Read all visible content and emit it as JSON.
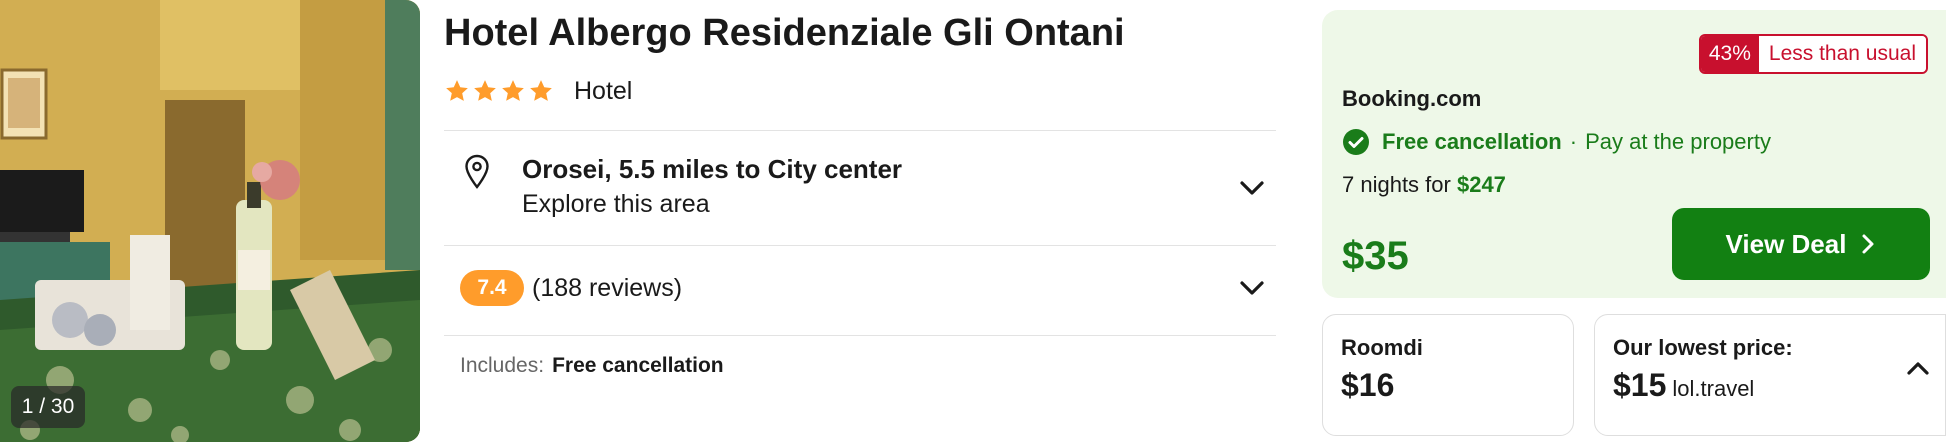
{
  "photo": {
    "counter": "1 / 30"
  },
  "hotel": {
    "name": "Hotel Albergo Residenziale Gli Ontani",
    "stars": 4,
    "type": "Hotel"
  },
  "location": {
    "title": "Orosei, 5.5 miles to City center",
    "subtitle": "Explore this area"
  },
  "reviews": {
    "score": "7.4",
    "count": "(188 reviews)"
  },
  "includes": {
    "label": "Includes:",
    "value": "Free cancellation"
  },
  "deal": {
    "badge_pct": "43%",
    "badge_text": "Less than usual",
    "provider": "Booking.com",
    "free_cancel": "Free cancellation",
    "separator": "·",
    "pay": "Pay at the property",
    "nights_text": "7 nights for",
    "nights_total": "$247",
    "price": "$35",
    "button": "View Deal"
  },
  "alt_price": {
    "provider": "Roomdi",
    "price": "$16"
  },
  "lowest_price": {
    "label": "Our lowest price:",
    "price": "$15",
    "provider": "lol.travel"
  },
  "colors": {
    "brand_green": "#128012",
    "price_green": "#1a7c1a",
    "deal_bg": "#eef8e8",
    "badge_red": "#c8102e",
    "score_orange": "#ff9c2b",
    "star_orange": "#ff9c2b"
  },
  "icons": [
    "star-icon",
    "map-pin-icon",
    "chevron-down-icon",
    "check-circle-icon",
    "chevron-right-icon",
    "chevron-up-icon"
  ]
}
